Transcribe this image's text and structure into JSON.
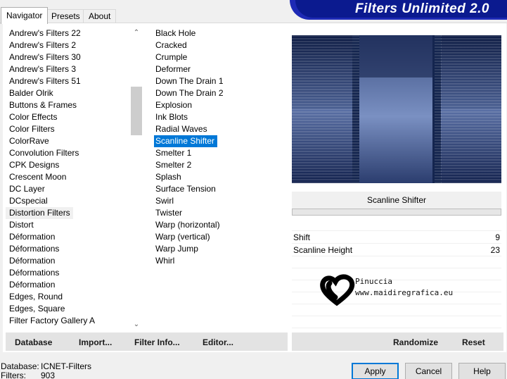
{
  "tabs": [
    {
      "label": "Navigator"
    },
    {
      "label": "Presets"
    },
    {
      "label": "About"
    }
  ],
  "banner_title": "Filters Unlimited 2.0",
  "categories": [
    "Andrew's Filters 22",
    "Andrew's Filters 2",
    "Andrew's Filters 30",
    "Andrew's Filters 3",
    "Andrew's Filters 51",
    "Balder Olrik",
    "Buttons & Frames",
    "Color Effects",
    "Color Filters",
    "ColorRave",
    "Convolution Filters",
    "CPK Designs",
    "Crescent Moon",
    "DC Layer",
    "DCspecial",
    "Distortion Filters",
    "Distort",
    "Déformation",
    "Déformations",
    "Déformation",
    "Déformations",
    "Déformation",
    "Edges, Round",
    "Edges, Square",
    "Filter Factory Gallery A"
  ],
  "selected_category": "Distortion Filters",
  "filters": [
    "Black Hole",
    "Cracked",
    "Crumple",
    "Deformer",
    "Down The Drain 1",
    "Down The Drain 2",
    "Explosion",
    "Ink Blots",
    "Radial Waves",
    "Scanline Shifter",
    "Smelter 1",
    "Smelter 2",
    "Splash",
    "Surface Tension",
    "Swirl",
    "Twister",
    "Warp (horizontal)",
    "Warp (vertical)",
    "Warp Jump",
    "Whirl"
  ],
  "selected_filter": "Scanline Shifter",
  "left_bar": {
    "database": "Database",
    "import": "Import...",
    "filter_info": "Filter Info...",
    "editor": "Editor..."
  },
  "right_bar": {
    "randomize": "Randomize",
    "reset": "Reset"
  },
  "current_filter_name": "Scanline Shifter",
  "params": [
    {
      "name": "Shift",
      "value": "9"
    },
    {
      "name": "Scanline Height",
      "value": "23"
    }
  ],
  "watermark": {
    "name": "Pinuccia",
    "site": "www.maidiregrafica.eu"
  },
  "status": {
    "database_label": "Database:",
    "database_value": "ICNET-Filters",
    "filters_label": "Filters:",
    "filters_value": "903"
  },
  "buttons": {
    "apply": "Apply",
    "cancel": "Cancel",
    "help": "Help"
  },
  "colors": {
    "accent": "#0078d7",
    "banner": "#0b1a8f",
    "preview_dark": "#0e1c44",
    "preview_light": "#6d84b8"
  }
}
